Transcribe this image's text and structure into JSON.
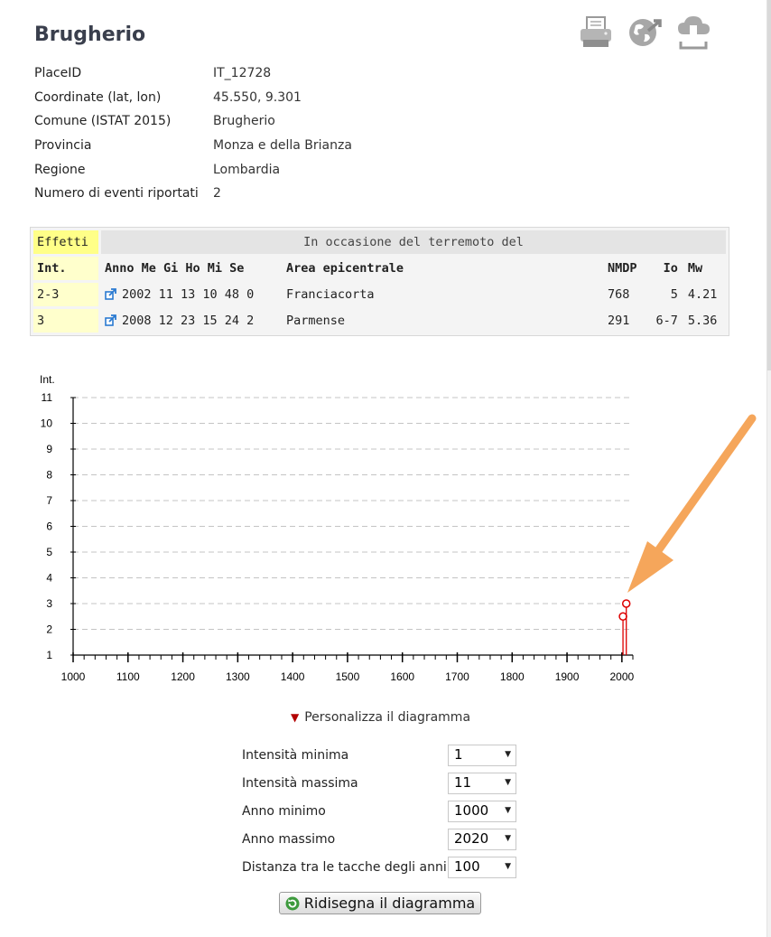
{
  "place": {
    "name": "Brugherio",
    "fields": [
      {
        "label": "PlaceID",
        "value": "IT_12728"
      },
      {
        "label": "Coordinate (lat, lon)",
        "value": "45.550, 9.301"
      },
      {
        "label": "Comune (ISTAT 2015)",
        "value": "Brugherio"
      },
      {
        "label": "Provincia",
        "value": "Monza e della Brianza"
      },
      {
        "label": "Regione",
        "value": "Lombardia"
      },
      {
        "label": "Numero di eventi riportati",
        "value": "2"
      }
    ]
  },
  "toolbar": {
    "icons": [
      "printer-icon",
      "globe-export-icon",
      "cloud-download-icon"
    ]
  },
  "events_table": {
    "effects_header": "Effetti",
    "occasion_header": "In occasione del terremoto del",
    "columns": {
      "int": "Int.",
      "date": "Anno Me Gi Ho Mi Se",
      "area": "Area epicentrale",
      "nmdp": "NMDP",
      "io": "Io",
      "mw": "Mw"
    },
    "rows": [
      {
        "int": "2-3",
        "date": "2002 11 13 10 48 0",
        "area": "Franciacorta",
        "nmdp": "768",
        "io": "5",
        "mw": "4.21"
      },
      {
        "int": "3",
        "date": "2008 12 23 15 24 2",
        "area": "Parmense",
        "nmdp": "291",
        "io": "6-7",
        "mw": "5.36"
      }
    ]
  },
  "chart_data": {
    "type": "scatter",
    "ylabel": "Int.",
    "xlim": [
      1000,
      2020
    ],
    "ylim": [
      1,
      11
    ],
    "x_ticks": [
      "1000",
      "1100",
      "1200",
      "1300",
      "1400",
      "1500",
      "1600",
      "1700",
      "1800",
      "1900",
      "2000"
    ],
    "y_ticks": [
      "1",
      "2",
      "3",
      "4",
      "5",
      "6",
      "7",
      "8",
      "9",
      "10",
      "11"
    ],
    "points": [
      {
        "x": 2002,
        "y": 2.5,
        "label": "2-3"
      },
      {
        "x": 2008,
        "y": 3,
        "label": "3"
      }
    ],
    "grid": true,
    "marker_color": "#dd0000",
    "annotation_arrow_color": "#f5a65b"
  },
  "customize": {
    "label": "Personalizza il diagramma"
  },
  "form": [
    {
      "label": "Intensità minima",
      "value": "1"
    },
    {
      "label": "Intensità massima",
      "value": "11"
    },
    {
      "label": "Anno minimo",
      "value": "1000"
    },
    {
      "label": "Anno massimo",
      "value": "2020"
    },
    {
      "label": "Distanza tra le tacche degli anni",
      "value": "100"
    }
  ],
  "redraw_button": {
    "label": "Ridisegna il diagramma"
  }
}
